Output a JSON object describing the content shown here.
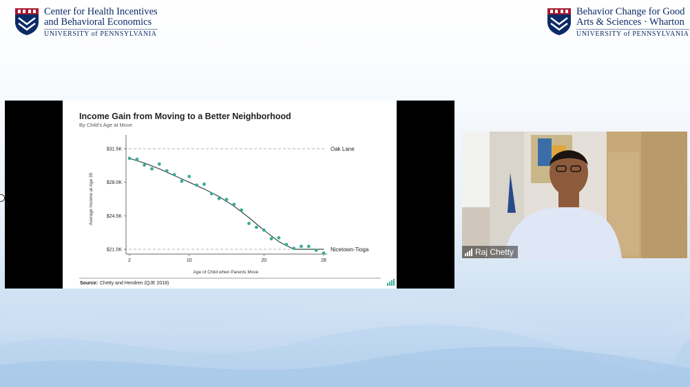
{
  "logos": {
    "left": {
      "line1": "Center for Health Incentives",
      "line2": "and Behavioral Economics",
      "line3": "UNIVERSITY of PENNSYLVANIA"
    },
    "right": {
      "line1": "Behavior Change for Good",
      "line2": "Arts & Sciences · Wharton",
      "line3": "UNIVERSITY of PENNSYLVANIA"
    }
  },
  "participant": {
    "name": "Raj Chetty",
    "signal_icon": "signal-bars-icon"
  },
  "slide": {
    "source_label": "Source:",
    "source_text": "Chetty and Hendren (QJE 2018)",
    "brand_icon": "opportunity-insights-icon"
  },
  "chart_data": {
    "type": "scatter",
    "title": "Income Gain from Moving to a Better Neighborhood",
    "subtitle": "By Child's Age at Move",
    "xlabel": "Age of Child when Parents Move",
    "ylabel": "Average Income at Age 35",
    "xlim": [
      2,
      28
    ],
    "ylim": [
      21000,
      31500
    ],
    "x_ticks": [
      2,
      10,
      20,
      28
    ],
    "y_ticks": [
      21000,
      24500,
      28000,
      31500
    ],
    "y_tick_labels": [
      "$21.0K",
      "$24.5K",
      "$28.0K",
      "$31.5K"
    ],
    "reference_lines": [
      {
        "label": "Oak Lane",
        "value": 31500
      },
      {
        "label": "Nicetown-Tioga",
        "value": 21000
      }
    ],
    "x": [
      2,
      3,
      4,
      5,
      6,
      7,
      8,
      9,
      10,
      11,
      12,
      13,
      14,
      15,
      16,
      17,
      18,
      19,
      20,
      21,
      22,
      23,
      24,
      25,
      26,
      27,
      28
    ],
    "y": [
      30500,
      30400,
      29800,
      29400,
      29900,
      29200,
      28800,
      28100,
      28600,
      27700,
      27800,
      26800,
      26300,
      26200,
      25700,
      25100,
      23700,
      23300,
      23000,
      22100,
      22200,
      21500,
      21100,
      21300,
      21300,
      20900,
      20600
    ],
    "fit_line": {
      "x": [
        2,
        4,
        6,
        8,
        10,
        12,
        14,
        16,
        18,
        20,
        22,
        24,
        25,
        26,
        27,
        28
      ],
      "y": [
        30500,
        30000,
        29400,
        28700,
        28000,
        27300,
        26500,
        25500,
        24300,
        23000,
        21800,
        21000,
        21000,
        21000,
        21000,
        21000
      ]
    },
    "colors": {
      "points": "#3aab96",
      "fit_line": "#2f4a43",
      "reference_lines": "#9a9a9a",
      "axis": "#333333"
    }
  }
}
